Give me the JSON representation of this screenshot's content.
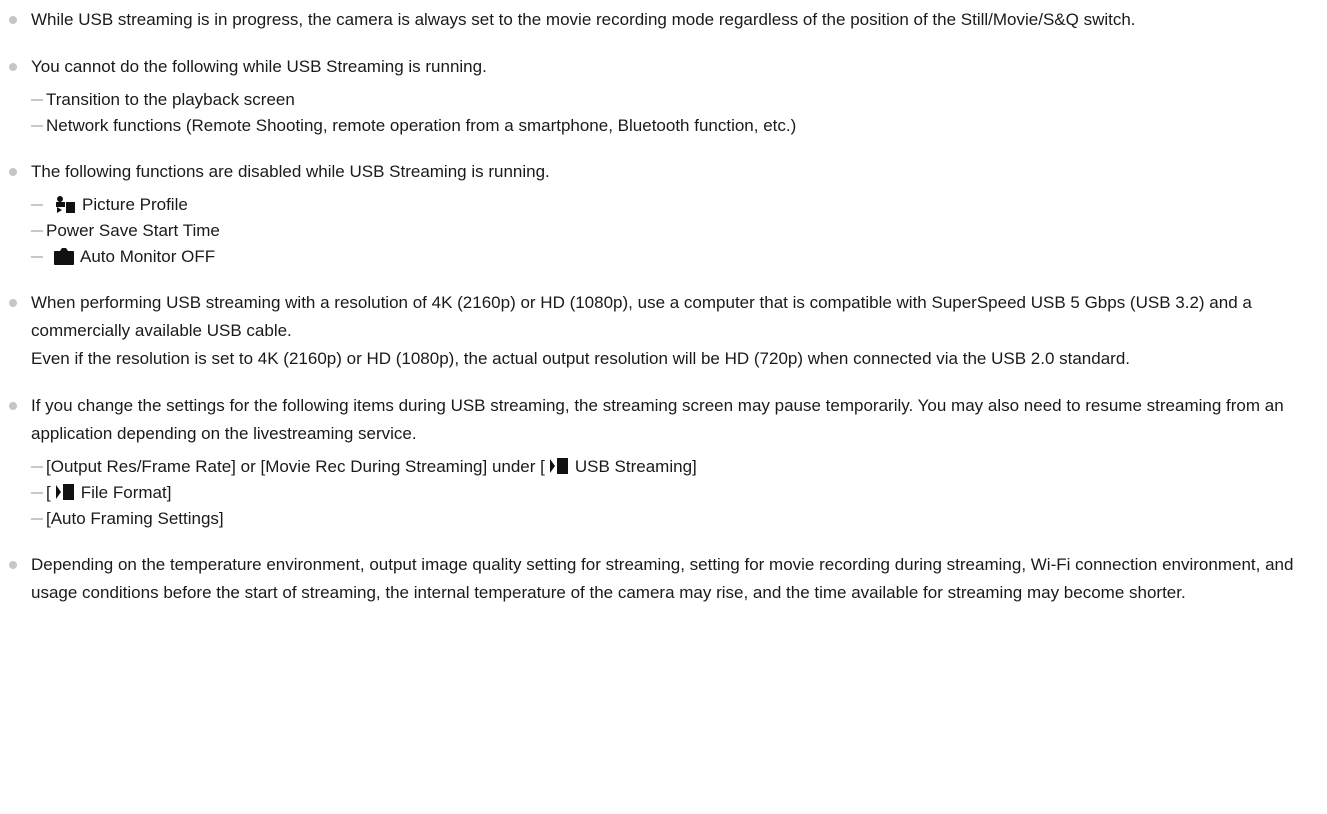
{
  "notes": [
    {
      "text": "While USB streaming is in progress, the camera is always set to the movie recording mode regardless of the position of the Still/Movie/S&Q switch."
    },
    {
      "text": "You cannot do the following while USB Streaming is running.",
      "subitems": [
        "Transition to the playback screen",
        "Network functions (Remote Shooting, remote operation from a smartphone, Bluetooth function, etc.)"
      ]
    },
    {
      "text": "The following functions are disabled while USB Streaming is running.",
      "subitems": [
        "Picture Profile",
        "Power Save Start Time",
        "Auto Monitor OFF"
      ]
    },
    {
      "text": "When performing USB streaming with a resolution of 4K (2160p) or HD (1080p), use a computer that is compatible with SuperSpeed USB 5 Gbps (USB 3.2) and a commercially available USB cable.",
      "text2": "Even if the resolution is set to 4K (2160p) or HD (1080p), the actual output resolution will be HD (720p) when connected via the USB 2.0 standard."
    },
    {
      "text": "If you change the settings for the following items during USB streaming, the streaming screen may pause temporarily. You may also need to resume streaming from an application depending on the livestreaming service.",
      "subitems": [
        {
          "before": "[Output Res/Frame Rate] or [Movie Rec During Streaming] under [",
          "after": "USB Streaming]"
        },
        {
          "before": "[",
          "after": "File Format]"
        },
        "[Auto Framing Settings]"
      ]
    },
    {
      "text": "Depending on the temperature environment, output image quality setting for streaming, setting for movie recording during streaming, Wi-Fi connection environment, and usage conditions before the start of streaming, the internal temperature of the camera may rise, and the time available for streaming may become shorter."
    }
  ],
  "icons": {
    "picture_profile": "picture-profile-icon",
    "still_camera": "still-camera-icon",
    "movie": "movie-mode-icon"
  },
  "colors": {
    "text": "#1a1a1a",
    "bullet": "#c6c6c6",
    "dash": "#c8c8c8"
  }
}
